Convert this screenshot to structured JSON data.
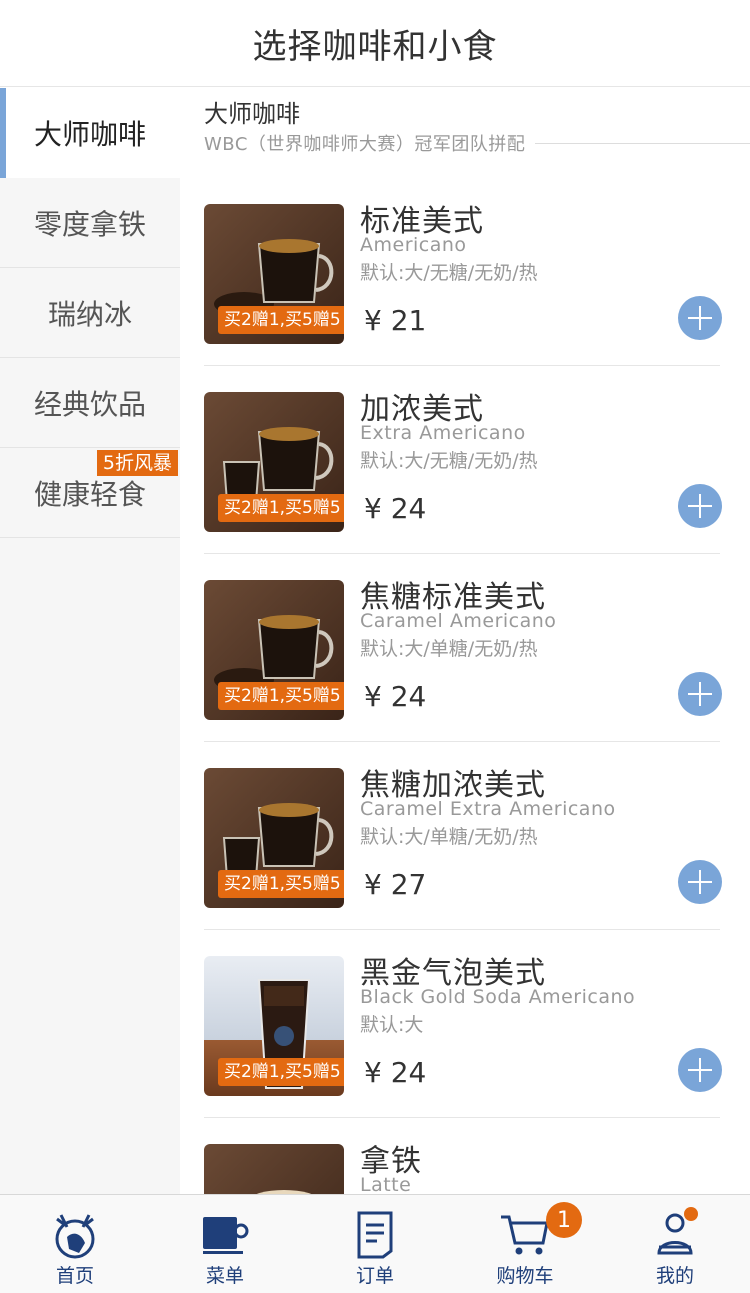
{
  "header": {
    "title": "选择咖啡和小食"
  },
  "sidebar": {
    "items": [
      {
        "label": "大师咖啡",
        "active": true
      },
      {
        "label": "零度拿铁"
      },
      {
        "label": "瑞纳冰"
      },
      {
        "label": "经典饮品"
      },
      {
        "label": "健康轻食",
        "badge": "5折风暴"
      }
    ]
  },
  "section": {
    "title": "大师咖啡",
    "subtitle": "WBC（世界咖啡师大赛）冠军团队拼配"
  },
  "products": [
    {
      "name": "标准美式",
      "english": "Americano",
      "default": "默认:大/无糖/无奶/热",
      "price": "¥ 21",
      "promo": "买2赠1,买5赠5",
      "image": "hot-americano"
    },
    {
      "name": "加浓美式",
      "english": "Extra Americano",
      "default": "默认:大/无糖/无奶/热",
      "price": "¥ 24",
      "promo": "买2赠1,买5赠5",
      "image": "hot-extra-americano"
    },
    {
      "name": "焦糖标准美式",
      "english": "Caramel Americano",
      "default": "默认:大/单糖/无奶/热",
      "price": "¥ 24",
      "promo": "买2赠1,买5赠5",
      "image": "hot-americano"
    },
    {
      "name": "焦糖加浓美式",
      "english": "Caramel Extra Americano",
      "default": "默认:大/单糖/无奶/热",
      "price": "¥ 27",
      "promo": "买2赠1,买5赠5",
      "image": "hot-extra-americano"
    },
    {
      "name": "黑金气泡美式",
      "english": "Black Gold Soda Americano",
      "default": "默认:大",
      "price": "¥ 24",
      "promo": "买2赠1,买5赠5",
      "image": "iced-soda-americano"
    },
    {
      "name": "拿铁",
      "english": "Latte",
      "default": "",
      "price": "",
      "promo": "",
      "image": "latte"
    }
  ],
  "tabbar": {
    "items": [
      {
        "label": "首页",
        "icon": "deer-logo-icon"
      },
      {
        "label": "菜单",
        "icon": "cup-icon"
      },
      {
        "label": "订单",
        "icon": "order-list-icon"
      },
      {
        "label": "购物车",
        "icon": "cart-icon"
      },
      {
        "label": "我的",
        "icon": "profile-icon"
      }
    ],
    "cart_count": "1"
  },
  "colors": {
    "accent": "#7aa5d8",
    "promo": "#e36a11",
    "brand": "#1f3f7a"
  }
}
